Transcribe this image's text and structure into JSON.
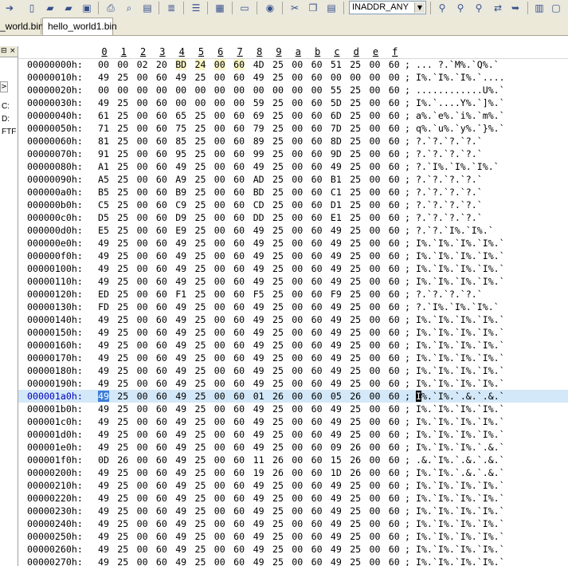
{
  "toolbar": {
    "icons": [
      "forward-icon",
      "new-file-icon",
      "open-folder-icon",
      "open-icon",
      "save-icon",
      "print-icon",
      "print-preview-icon",
      "export-icon",
      "properties-icon",
      "list-icon",
      "hex-view-icon",
      "document-icon",
      "globe-icon",
      "cut-icon",
      "copy-icon",
      "paste-icon",
      "find-icon",
      "find-next-icon",
      "find-prev-icon",
      "replace-icon",
      "goto-icon",
      "split-icon",
      "window-icon"
    ],
    "combo_value": "INADDR_ANY"
  },
  "tabs": [
    {
      "label": "_world.bin",
      "active": false
    },
    {
      "label": "hello_world1.bin",
      "active": true
    }
  ],
  "left_panel": {
    "header_buttons": [
      "⊟",
      "×"
    ],
    "arrow": ">",
    "items": [
      "C:",
      "D:",
      "FTF"
    ]
  },
  "hex": {
    "columns": [
      "0",
      "1",
      "2",
      "3",
      "4",
      "5",
      "6",
      "7",
      "8",
      "9",
      "a",
      "b",
      "c",
      "d",
      "e",
      "f"
    ],
    "rows": [
      {
        "addr": "00000000h:",
        "bytes": [
          "00",
          "00",
          "02",
          "20",
          "BD",
          "24",
          "00",
          "60",
          "4D",
          "25",
          "00",
          "60",
          "51",
          "25",
          "00",
          "60"
        ],
        "ascii": "; ... ?.`M%.`Q%.`"
      },
      {
        "addr": "00000010h:",
        "bytes": [
          "49",
          "25",
          "00",
          "60",
          "49",
          "25",
          "00",
          "60",
          "49",
          "25",
          "00",
          "60",
          "00",
          "00",
          "00",
          "00"
        ],
        "ascii": "; I%.`I%.`I%.`...."
      },
      {
        "addr": "00000020h:",
        "bytes": [
          "00",
          "00",
          "00",
          "00",
          "00",
          "00",
          "00",
          "00",
          "00",
          "00",
          "00",
          "00",
          "55",
          "25",
          "00",
          "60"
        ],
        "ascii": "; ............U%.`"
      },
      {
        "addr": "00000030h:",
        "bytes": [
          "49",
          "25",
          "00",
          "60",
          "00",
          "00",
          "00",
          "00",
          "59",
          "25",
          "00",
          "60",
          "5D",
          "25",
          "00",
          "60"
        ],
        "ascii": "; I%.`....Y%.`]%.`"
      },
      {
        "addr": "00000040h:",
        "bytes": [
          "61",
          "25",
          "00",
          "60",
          "65",
          "25",
          "00",
          "60",
          "69",
          "25",
          "00",
          "60",
          "6D",
          "25",
          "00",
          "60"
        ],
        "ascii": "; a%.`e%.`i%.`m%.`"
      },
      {
        "addr": "00000050h:",
        "bytes": [
          "71",
          "25",
          "00",
          "60",
          "75",
          "25",
          "00",
          "60",
          "79",
          "25",
          "00",
          "60",
          "7D",
          "25",
          "00",
          "60"
        ],
        "ascii": "; q%.`u%.`y%.`}%.`"
      },
      {
        "addr": "00000060h:",
        "bytes": [
          "81",
          "25",
          "00",
          "60",
          "85",
          "25",
          "00",
          "60",
          "89",
          "25",
          "00",
          "60",
          "8D",
          "25",
          "00",
          "60"
        ],
        "ascii": "; ?.`?.`?.`?.`"
      },
      {
        "addr": "00000070h:",
        "bytes": [
          "91",
          "25",
          "00",
          "60",
          "95",
          "25",
          "00",
          "60",
          "99",
          "25",
          "00",
          "60",
          "9D",
          "25",
          "00",
          "60"
        ],
        "ascii": "; ?.`?.`?.`?.`"
      },
      {
        "addr": "00000080h:",
        "bytes": [
          "A1",
          "25",
          "00",
          "60",
          "49",
          "25",
          "00",
          "60",
          "49",
          "25",
          "00",
          "60",
          "49",
          "25",
          "00",
          "60"
        ],
        "ascii": "; ?.`I%.`I%.`I%.`"
      },
      {
        "addr": "00000090h:",
        "bytes": [
          "A5",
          "25",
          "00",
          "60",
          "A9",
          "25",
          "00",
          "60",
          "AD",
          "25",
          "00",
          "60",
          "B1",
          "25",
          "00",
          "60"
        ],
        "ascii": "; ?.`?.`?.`?.`"
      },
      {
        "addr": "000000a0h:",
        "bytes": [
          "B5",
          "25",
          "00",
          "60",
          "B9",
          "25",
          "00",
          "60",
          "BD",
          "25",
          "00",
          "60",
          "C1",
          "25",
          "00",
          "60"
        ],
        "ascii": "; ?.`?.`?.`?.`"
      },
      {
        "addr": "000000b0h:",
        "bytes": [
          "C5",
          "25",
          "00",
          "60",
          "C9",
          "25",
          "00",
          "60",
          "CD",
          "25",
          "00",
          "60",
          "D1",
          "25",
          "00",
          "60"
        ],
        "ascii": "; ?.`?.`?.`?.`"
      },
      {
        "addr": "000000c0h:",
        "bytes": [
          "D5",
          "25",
          "00",
          "60",
          "D9",
          "25",
          "00",
          "60",
          "DD",
          "25",
          "00",
          "60",
          "E1",
          "25",
          "00",
          "60"
        ],
        "ascii": "; ?.`?.`?.`?.`"
      },
      {
        "addr": "000000d0h:",
        "bytes": [
          "E5",
          "25",
          "00",
          "60",
          "E9",
          "25",
          "00",
          "60",
          "49",
          "25",
          "00",
          "60",
          "49",
          "25",
          "00",
          "60"
        ],
        "ascii": "; ?.`?.`I%.`I%.`"
      },
      {
        "addr": "000000e0h:",
        "bytes": [
          "49",
          "25",
          "00",
          "60",
          "49",
          "25",
          "00",
          "60",
          "49",
          "25",
          "00",
          "60",
          "49",
          "25",
          "00",
          "60"
        ],
        "ascii": "; I%.`I%.`I%.`I%.`"
      },
      {
        "addr": "000000f0h:",
        "bytes": [
          "49",
          "25",
          "00",
          "60",
          "49",
          "25",
          "00",
          "60",
          "49",
          "25",
          "00",
          "60",
          "49",
          "25",
          "00",
          "60"
        ],
        "ascii": "; I%.`I%.`I%.`I%.`"
      },
      {
        "addr": "00000100h:",
        "bytes": [
          "49",
          "25",
          "00",
          "60",
          "49",
          "25",
          "00",
          "60",
          "49",
          "25",
          "00",
          "60",
          "49",
          "25",
          "00",
          "60"
        ],
        "ascii": "; I%.`I%.`I%.`I%.`"
      },
      {
        "addr": "00000110h:",
        "bytes": [
          "49",
          "25",
          "00",
          "60",
          "49",
          "25",
          "00",
          "60",
          "49",
          "25",
          "00",
          "60",
          "49",
          "25",
          "00",
          "60"
        ],
        "ascii": "; I%.`I%.`I%.`I%.`"
      },
      {
        "addr": "00000120h:",
        "bytes": [
          "ED",
          "25",
          "00",
          "60",
          "F1",
          "25",
          "00",
          "60",
          "F5",
          "25",
          "00",
          "60",
          "F9",
          "25",
          "00",
          "60"
        ],
        "ascii": "; ?.`?.`?.`?.`"
      },
      {
        "addr": "00000130h:",
        "bytes": [
          "FD",
          "25",
          "00",
          "60",
          "49",
          "25",
          "00",
          "60",
          "49",
          "25",
          "00",
          "60",
          "49",
          "25",
          "00",
          "60"
        ],
        "ascii": "; ?.`I%.`I%.`I%.`"
      },
      {
        "addr": "00000140h:",
        "bytes": [
          "49",
          "25",
          "00",
          "60",
          "49",
          "25",
          "00",
          "60",
          "49",
          "25",
          "00",
          "60",
          "49",
          "25",
          "00",
          "60"
        ],
        "ascii": "; I%.`I%.`I%.`I%.`"
      },
      {
        "addr": "00000150h:",
        "bytes": [
          "49",
          "25",
          "00",
          "60",
          "49",
          "25",
          "00",
          "60",
          "49",
          "25",
          "00",
          "60",
          "49",
          "25",
          "00",
          "60"
        ],
        "ascii": "; I%.`I%.`I%.`I%.`"
      },
      {
        "addr": "00000160h:",
        "bytes": [
          "49",
          "25",
          "00",
          "60",
          "49",
          "25",
          "00",
          "60",
          "49",
          "25",
          "00",
          "60",
          "49",
          "25",
          "00",
          "60"
        ],
        "ascii": "; I%.`I%.`I%.`I%.`"
      },
      {
        "addr": "00000170h:",
        "bytes": [
          "49",
          "25",
          "00",
          "60",
          "49",
          "25",
          "00",
          "60",
          "49",
          "25",
          "00",
          "60",
          "49",
          "25",
          "00",
          "60"
        ],
        "ascii": "; I%.`I%.`I%.`I%.`"
      },
      {
        "addr": "00000180h:",
        "bytes": [
          "49",
          "25",
          "00",
          "60",
          "49",
          "25",
          "00",
          "60",
          "49",
          "25",
          "00",
          "60",
          "49",
          "25",
          "00",
          "60"
        ],
        "ascii": "; I%.`I%.`I%.`I%.`"
      },
      {
        "addr": "00000190h:",
        "bytes": [
          "49",
          "25",
          "00",
          "60",
          "49",
          "25",
          "00",
          "60",
          "49",
          "25",
          "00",
          "60",
          "49",
          "25",
          "00",
          "60"
        ],
        "ascii": "; I%.`I%.`I%.`I%.`"
      },
      {
        "addr": "000001a0h:",
        "bytes": [
          "49",
          "25",
          "00",
          "60",
          "49",
          "25",
          "00",
          "60",
          "01",
          "26",
          "00",
          "60",
          "05",
          "26",
          "00",
          "60"
        ],
        "ascii": "; I%.`I%.`.&.`.&.`",
        "selected": true
      },
      {
        "addr": "000001b0h:",
        "bytes": [
          "49",
          "25",
          "00",
          "60",
          "49",
          "25",
          "00",
          "60",
          "49",
          "25",
          "00",
          "60",
          "49",
          "25",
          "00",
          "60"
        ],
        "ascii": "; I%.`I%.`I%.`I%.`"
      },
      {
        "addr": "000001c0h:",
        "bytes": [
          "49",
          "25",
          "00",
          "60",
          "49",
          "25",
          "00",
          "60",
          "49",
          "25",
          "00",
          "60",
          "49",
          "25",
          "00",
          "60"
        ],
        "ascii": "; I%.`I%.`I%.`I%.`"
      },
      {
        "addr": "000001d0h:",
        "bytes": [
          "49",
          "25",
          "00",
          "60",
          "49",
          "25",
          "00",
          "60",
          "49",
          "25",
          "00",
          "60",
          "49",
          "25",
          "00",
          "60"
        ],
        "ascii": "; I%.`I%.`I%.`I%.`"
      },
      {
        "addr": "000001e0h:",
        "bytes": [
          "49",
          "25",
          "00",
          "60",
          "49",
          "25",
          "00",
          "60",
          "49",
          "25",
          "00",
          "60",
          "09",
          "26",
          "00",
          "60"
        ],
        "ascii": "; I%.`I%.`I%.`.&.`"
      },
      {
        "addr": "000001f0h:",
        "bytes": [
          "0D",
          "26",
          "00",
          "60",
          "49",
          "25",
          "00",
          "60",
          "11",
          "26",
          "00",
          "60",
          "15",
          "26",
          "00",
          "60"
        ],
        "ascii": "; .&.`I%.`.&.`.&.`"
      },
      {
        "addr": "00000200h:",
        "bytes": [
          "49",
          "25",
          "00",
          "60",
          "49",
          "25",
          "00",
          "60",
          "19",
          "26",
          "00",
          "60",
          "1D",
          "26",
          "00",
          "60"
        ],
        "ascii": "; I%.`I%.`.&.`.&.`"
      },
      {
        "addr": "00000210h:",
        "bytes": [
          "49",
          "25",
          "00",
          "60",
          "49",
          "25",
          "00",
          "60",
          "49",
          "25",
          "00",
          "60",
          "49",
          "25",
          "00",
          "60"
        ],
        "ascii": "; I%.`I%.`I%.`I%.`"
      },
      {
        "addr": "00000220h:",
        "bytes": [
          "49",
          "25",
          "00",
          "60",
          "49",
          "25",
          "00",
          "60",
          "49",
          "25",
          "00",
          "60",
          "49",
          "25",
          "00",
          "60"
        ],
        "ascii": "; I%.`I%.`I%.`I%.`"
      },
      {
        "addr": "00000230h:",
        "bytes": [
          "49",
          "25",
          "00",
          "60",
          "49",
          "25",
          "00",
          "60",
          "49",
          "25",
          "00",
          "60",
          "49",
          "25",
          "00",
          "60"
        ],
        "ascii": "; I%.`I%.`I%.`I%.`"
      },
      {
        "addr": "00000240h:",
        "bytes": [
          "49",
          "25",
          "00",
          "60",
          "49",
          "25",
          "00",
          "60",
          "49",
          "25",
          "00",
          "60",
          "49",
          "25",
          "00",
          "60"
        ],
        "ascii": "; I%.`I%.`I%.`I%.`"
      },
      {
        "addr": "00000250h:",
        "bytes": [
          "49",
          "25",
          "00",
          "60",
          "49",
          "25",
          "00",
          "60",
          "49",
          "25",
          "00",
          "60",
          "49",
          "25",
          "00",
          "60"
        ],
        "ascii": "; I%.`I%.`I%.`I%.`"
      },
      {
        "addr": "00000260h:",
        "bytes": [
          "49",
          "25",
          "00",
          "60",
          "49",
          "25",
          "00",
          "60",
          "49",
          "25",
          "00",
          "60",
          "49",
          "25",
          "00",
          "60"
        ],
        "ascii": "; I%.`I%.`I%.`I%.`"
      },
      {
        "addr": "00000270h:",
        "bytes": [
          "49",
          "25",
          "00",
          "60",
          "49",
          "25",
          "00",
          "60",
          "49",
          "25",
          "00",
          "60",
          "49",
          "25",
          "00",
          "60"
        ],
        "ascii": "; I%.`I%.`I%.`I%.`"
      }
    ]
  },
  "colors": {
    "selected_row": "#d3e8f8",
    "cursor_byte": "#3c7dd8",
    "highlight_bytes": "#faf6c8",
    "selected_address": "#0000c0"
  }
}
